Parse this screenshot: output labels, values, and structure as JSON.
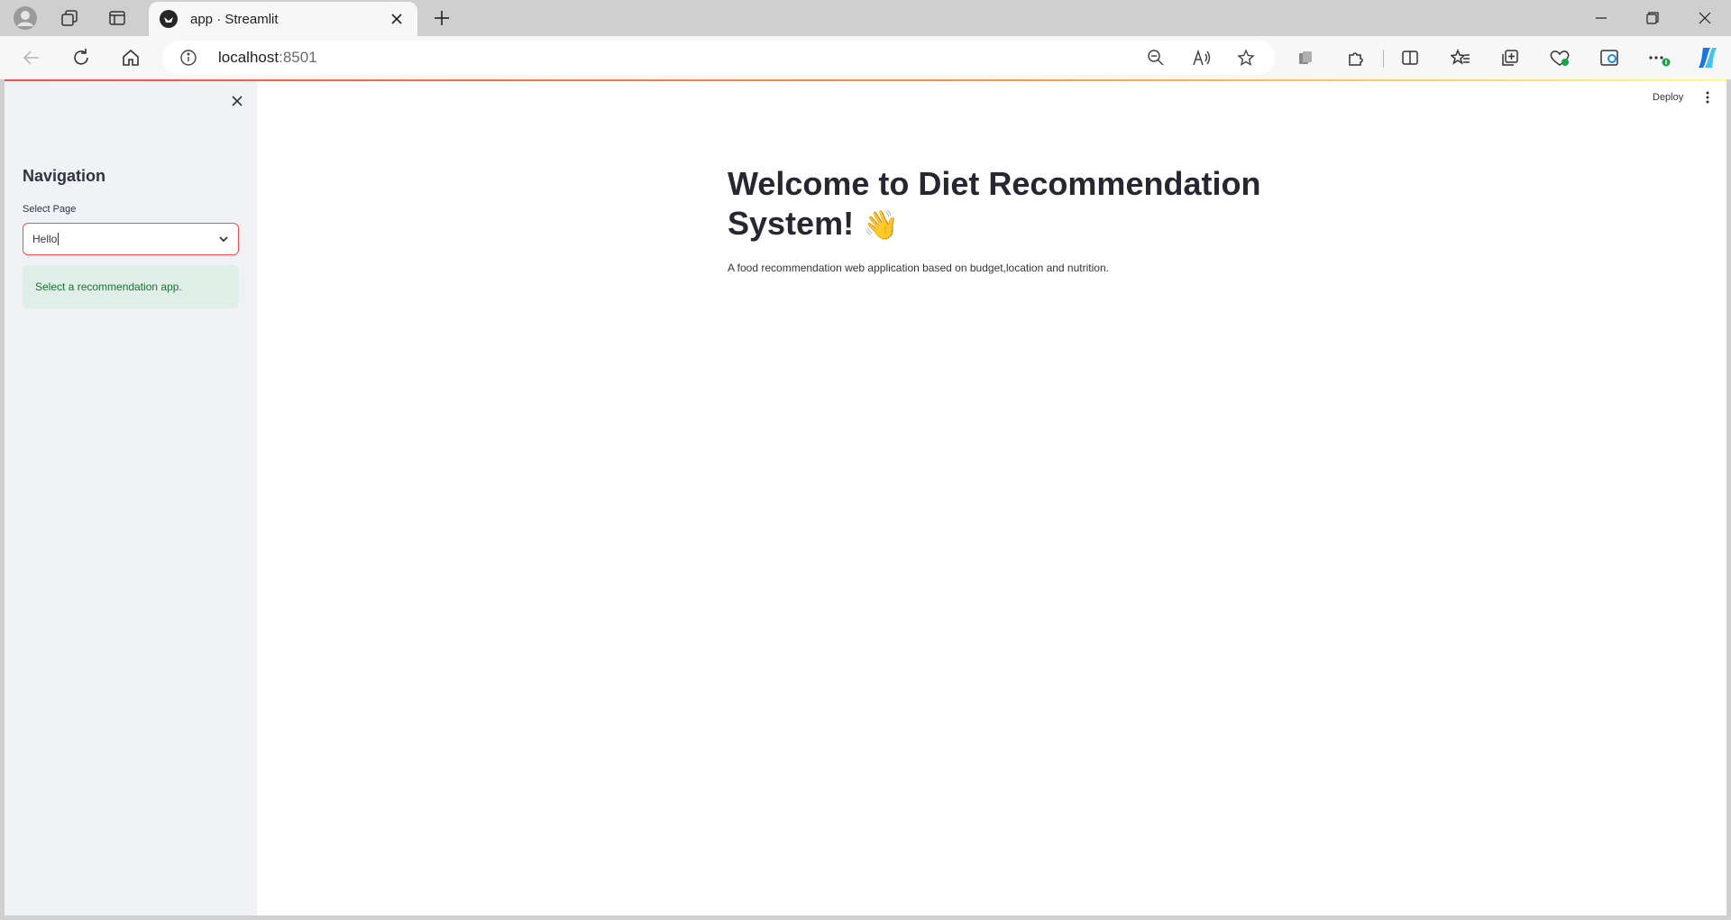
{
  "browser": {
    "tab_title": "app · Streamlit",
    "url_host": "localhost",
    "url_port": ":8501"
  },
  "sidebar": {
    "title": "Navigation",
    "select_label": "Select Page",
    "select_value": "Hello",
    "info_text": "Select a recommendation app."
  },
  "header": {
    "deploy_label": "Deploy"
  },
  "main": {
    "title": "Welcome to Diet Recommendation System!",
    "title_emoji": "👋",
    "description": "A food recommendation web application based on budget,location and nutrition."
  },
  "colors": {
    "accent": "#ff4b4b",
    "sidebar_bg": "#f0f2f6",
    "info_bg": "#dfeee6",
    "info_text": "#177233"
  }
}
